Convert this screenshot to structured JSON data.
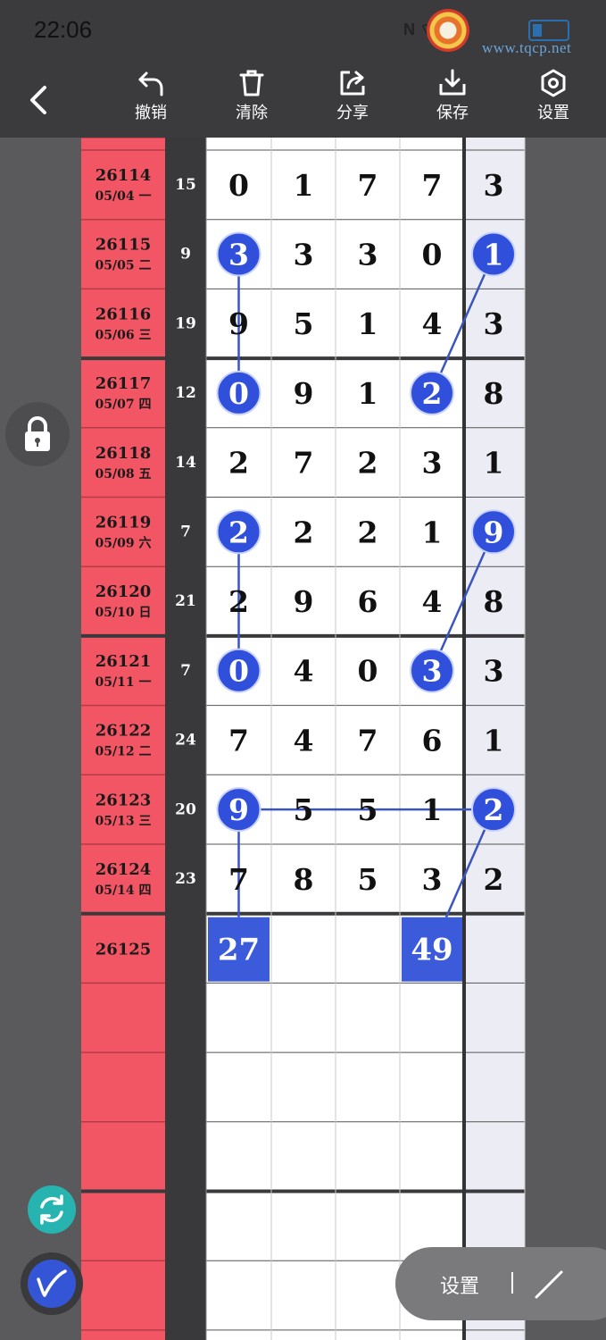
{
  "status": {
    "time": "22:06"
  },
  "watermark": {
    "text": "www.tqcp.net"
  },
  "toolbar": {
    "undo_label": "撤销",
    "clear_label": "清除",
    "share_label": "分享",
    "save_label": "保存",
    "settings_label": "设置"
  },
  "icons": {
    "back": "chevron-left-icon",
    "lock": "lock-icon",
    "sync": "sync-icon",
    "pen": "pen-icon",
    "line": "line-tool-icon"
  },
  "float_bar": {
    "settings_label": "设置"
  },
  "colors": {
    "issue_column": "#f25563",
    "sum_column": "#39393c",
    "marker": "#3050dc",
    "tail_column": "#ececf5",
    "answer_box": "#3b5bdb"
  },
  "rows": [
    {
      "issue": "26114",
      "date": "05/04 一",
      "sum": "15",
      "digits": [
        "0",
        "1",
        "7",
        "7",
        "3"
      ]
    },
    {
      "issue": "26115",
      "date": "05/05 二",
      "sum": "9",
      "digits": [
        "3",
        "3",
        "3",
        "0",
        "1"
      ]
    },
    {
      "issue": "26116",
      "date": "05/06 三",
      "sum": "19",
      "digits": [
        "9",
        "5",
        "1",
        "4",
        "3"
      ]
    },
    {
      "issue": "26117",
      "date": "05/07 四",
      "sum": "12",
      "digits": [
        "0",
        "9",
        "1",
        "2",
        "8"
      ]
    },
    {
      "issue": "26118",
      "date": "05/08 五",
      "sum": "14",
      "digits": [
        "2",
        "7",
        "2",
        "3",
        "1"
      ]
    },
    {
      "issue": "26119",
      "date": "05/09 六",
      "sum": "7",
      "digits": [
        "2",
        "2",
        "2",
        "1",
        "9"
      ]
    },
    {
      "issue": "26120",
      "date": "05/10 日",
      "sum": "21",
      "digits": [
        "2",
        "9",
        "6",
        "4",
        "8"
      ]
    },
    {
      "issue": "26121",
      "date": "05/11 一",
      "sum": "7",
      "digits": [
        "0",
        "4",
        "0",
        "3",
        "3"
      ]
    },
    {
      "issue": "26122",
      "date": "05/12 二",
      "sum": "24",
      "digits": [
        "7",
        "4",
        "7",
        "6",
        "1"
      ]
    },
    {
      "issue": "26123",
      "date": "05/13 三",
      "sum": "20",
      "digits": [
        "9",
        "5",
        "5",
        "1",
        "2"
      ]
    },
    {
      "issue": "26124",
      "date": "05/14 四",
      "sum": "23",
      "digits": [
        "7",
        "8",
        "5",
        "3",
        "2"
      ]
    }
  ],
  "markers": [
    {
      "row": 1,
      "col": 0
    },
    {
      "row": 3,
      "col": 0
    },
    {
      "row": 1,
      "col": 4
    },
    {
      "row": 3,
      "col": 3
    },
    {
      "row": 5,
      "col": 0
    },
    {
      "row": 7,
      "col": 0
    },
    {
      "row": 5,
      "col": 4
    },
    {
      "row": 7,
      "col": 3
    },
    {
      "row": 9,
      "col": 0
    },
    {
      "row": 9,
      "col": 4
    }
  ],
  "next_row": {
    "issue": "26125",
    "answers": [
      {
        "col": 0,
        "value": "27"
      },
      {
        "col": 3,
        "value": "49"
      }
    ]
  }
}
